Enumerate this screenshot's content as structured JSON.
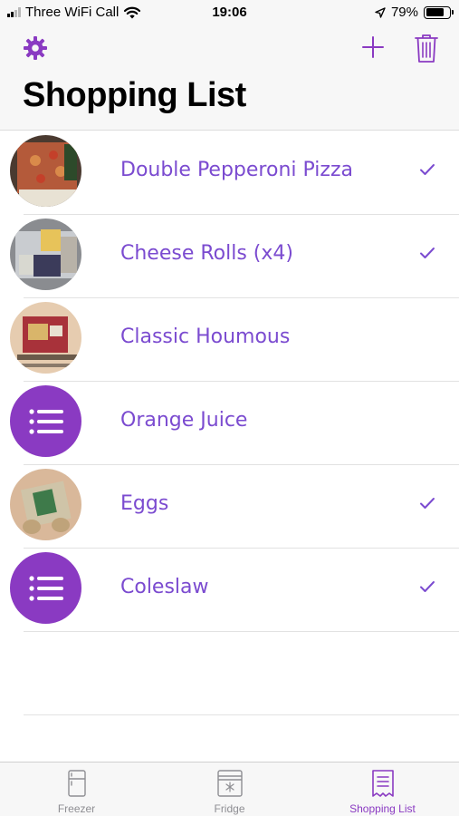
{
  "status_bar": {
    "carrier": "Three WiFi Call",
    "time": "19:06",
    "battery_percent": "79%",
    "battery_level": 0.79,
    "icons": [
      "signal-icon",
      "wifi-icon",
      "location-arrow-icon",
      "battery-icon"
    ]
  },
  "nav": {
    "title": "Shopping List",
    "settings_icon": "gear-icon",
    "add_icon": "plus-icon",
    "delete_icon": "trash-icon"
  },
  "items": [
    {
      "name": "Double Pepperoni Pizza",
      "checked": true,
      "thumb": "photo"
    },
    {
      "name": "Cheese Rolls (x4)",
      "checked": true,
      "thumb": "photo"
    },
    {
      "name": "Classic Houmous",
      "checked": false,
      "thumb": "photo"
    },
    {
      "name": "Orange Juice",
      "checked": false,
      "thumb": "list-icon"
    },
    {
      "name": "Eggs",
      "checked": true,
      "thumb": "photo"
    },
    {
      "name": "Coleslaw",
      "checked": true,
      "thumb": "list-icon"
    }
  ],
  "tabs": [
    {
      "label": "Freezer",
      "icon": "freezer-icon",
      "active": false
    },
    {
      "label": "Fridge",
      "icon": "fridge-icon",
      "active": false
    },
    {
      "label": "Shopping List",
      "icon": "receipt-list-icon",
      "active": true
    }
  ],
  "colors": {
    "accent": "#8a3ac2",
    "item_text": "#7b4bd0",
    "inactive_tab": "#8e8e93"
  }
}
